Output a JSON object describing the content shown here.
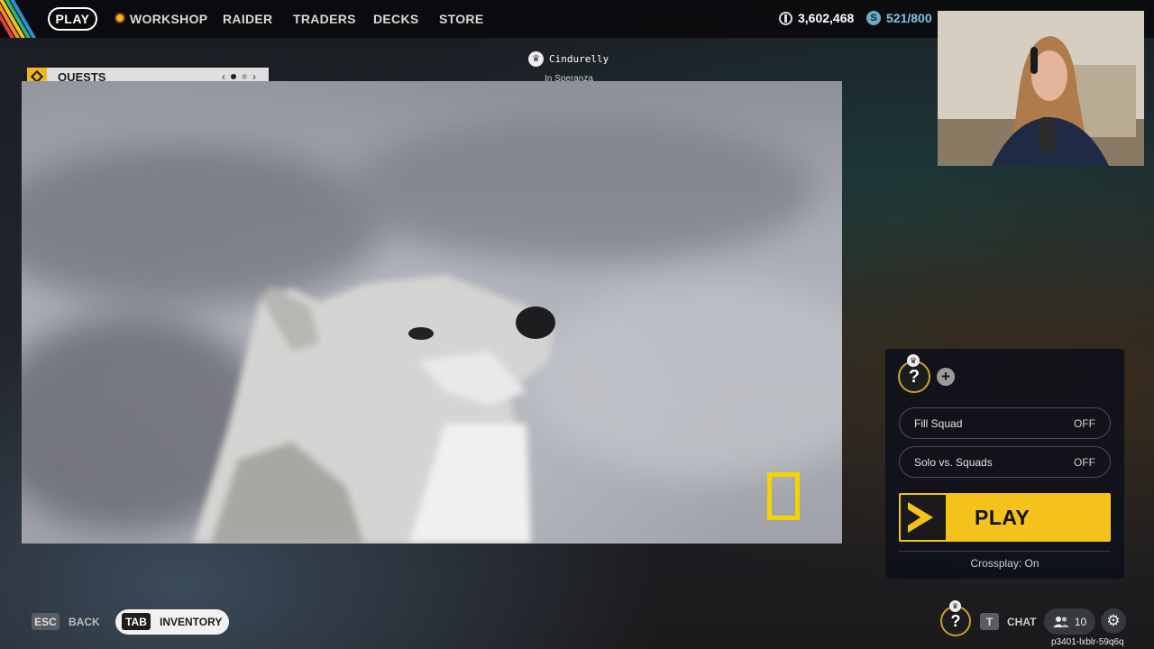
{
  "nav": {
    "play": "PLAY",
    "workshop": "WORKSHOP",
    "raider": "RAIDER",
    "traders": "TRADERS",
    "decks": "DECKS",
    "store": "STORE"
  },
  "currency": {
    "coins": "3,602,468",
    "credits": "521/800"
  },
  "quests": {
    "label": "QUESTS",
    "prev": "‹",
    "next": "›"
  },
  "friend": {
    "name": "Cindurelly",
    "status": "In Speranza"
  },
  "squad": {
    "slot_symbol": "?",
    "add_symbol": "+",
    "fill_squad": {
      "label": "Fill Squad",
      "value": "OFF"
    },
    "solo_vs_squads": {
      "label": "Solo vs. Squads",
      "value": "OFF"
    },
    "play_label": "PLAY",
    "crossplay": "Crossplay: On"
  },
  "bottom": {
    "esc_key": "ESC",
    "back_label": "BACK",
    "tab_key": "TAB",
    "inventory_label": "INVENTORY",
    "help_symbol": "?",
    "chat_key": "T",
    "chat_label": "CHAT",
    "friends_count": "10",
    "settings_icon": "⚙",
    "session_id": "p3401-lxblr-59q6q"
  },
  "colors": {
    "accent": "#f4c21b",
    "stripes": [
      "#e23b3b",
      "#f08a24",
      "#f4c21b",
      "#2bb673",
      "#2a8fd6"
    ]
  }
}
